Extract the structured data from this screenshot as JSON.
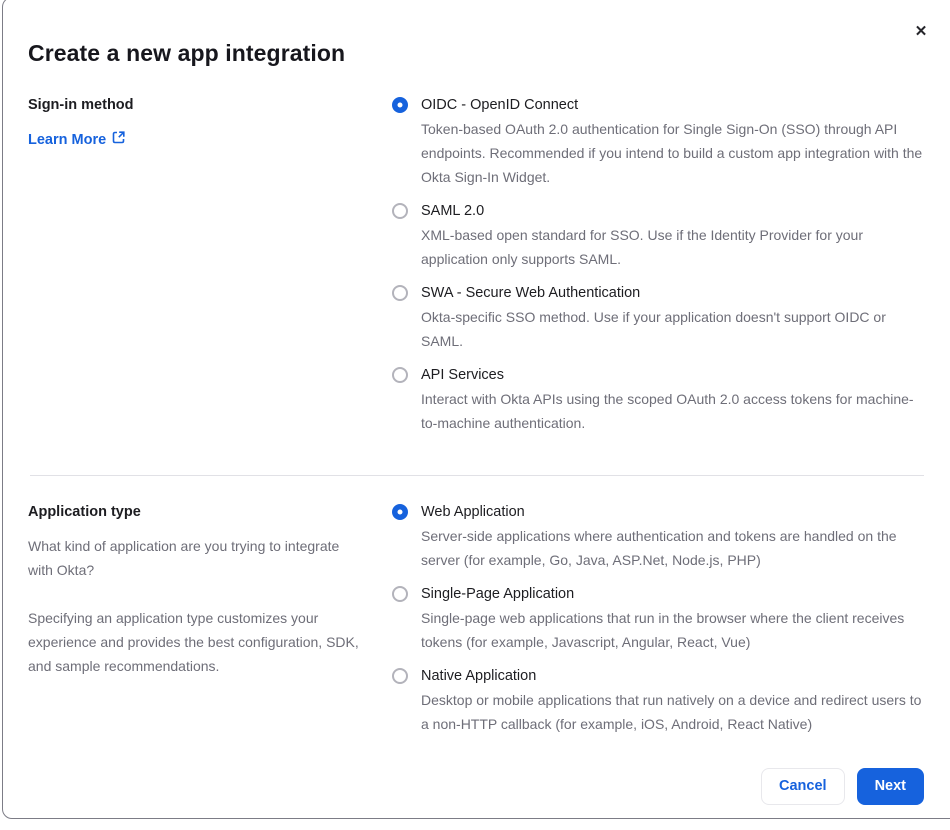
{
  "modal": {
    "title": "Create a new app integration",
    "close_glyph": "✕"
  },
  "signin_section": {
    "label": "Sign-in method",
    "learn_more_label": "Learn More",
    "options": [
      {
        "label": "OIDC - OpenID Connect",
        "description": "Token-based OAuth 2.0 authentication for Single Sign-On (SSO) through API endpoints. Recommended if you intend to build a custom app integration with the Okta Sign-In Widget.",
        "selected": true
      },
      {
        "label": "SAML 2.0",
        "description": "XML-based open standard for SSO. Use if the Identity Provider for your application only supports SAML.",
        "selected": false
      },
      {
        "label": "SWA - Secure Web Authentication",
        "description": "Okta-specific SSO method. Use if your application doesn't support OIDC or SAML.",
        "selected": false
      },
      {
        "label": "API Services",
        "description": "Interact with Okta APIs using the scoped OAuth 2.0 access tokens for machine-to-machine authentication.",
        "selected": false
      }
    ]
  },
  "apptype_section": {
    "label": "Application type",
    "description_1": "What kind of application are you trying to integrate with Okta?",
    "description_2": "Specifying an application type customizes your experience and provides the best configuration, SDK, and sample recommendations.",
    "options": [
      {
        "label": "Web Application",
        "description": "Server-side applications where authentication and tokens are handled on the server (for example, Go, Java, ASP.Net, Node.js, PHP)",
        "selected": true
      },
      {
        "label": "Single-Page Application",
        "description": "Single-page web applications that run in the browser where the client receives tokens (for example, Javascript, Angular, React, Vue)",
        "selected": false
      },
      {
        "label": "Native Application",
        "description": "Desktop or mobile applications that run natively on a device and redirect users to a non-HTTP callback (for example, iOS, Android, React Native)",
        "selected": false
      }
    ]
  },
  "footer": {
    "cancel_label": "Cancel",
    "next_label": "Next"
  },
  "colors": {
    "primary_blue": "#1662dd",
    "text_dark": "#1d1d21",
    "text_gray": "#6e6e78",
    "divider": "#e1e1e6",
    "radio_unselected_border": "#b3b3bb"
  }
}
